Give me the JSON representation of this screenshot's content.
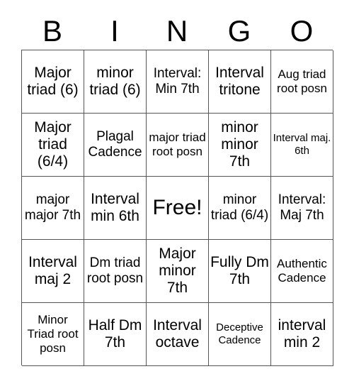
{
  "card": {
    "type": "bingo-card",
    "columns": 5,
    "rows": 5,
    "header_letters": [
      "B",
      "I",
      "N",
      "G",
      "O"
    ],
    "free_space": {
      "row": 3,
      "column": 3,
      "label": "Free!"
    },
    "colors": {
      "background": "#ffffff",
      "text": "#000000",
      "grid_line": "#555555"
    },
    "cells": [
      [
        {
          "text": "Major triad (6)",
          "size": "lg"
        },
        {
          "text": "minor triad (6)",
          "size": "lg"
        },
        {
          "text": "Interval: Min 7th",
          "size": "md"
        },
        {
          "text": "Interval tritone",
          "size": "lg"
        },
        {
          "text": "Aug triad root posn",
          "size": "sm"
        }
      ],
      [
        {
          "text": "Major triad (6/4)",
          "size": "lg"
        },
        {
          "text": "Plagal Cadence",
          "size": "md"
        },
        {
          "text": "major triad root posn",
          "size": "sm"
        },
        {
          "text": "minor minor 7th",
          "size": "lg"
        },
        {
          "text": "Interval maj. 6th",
          "size": "xs"
        }
      ],
      [
        {
          "text": "major major 7th",
          "size": "md"
        },
        {
          "text": "Interval min 6th",
          "size": "lg"
        },
        {
          "text": "Free!",
          "size": "xl"
        },
        {
          "text": "minor triad (6/4)",
          "size": "md"
        },
        {
          "text": "Interval: Maj 7th",
          "size": "md"
        }
      ],
      [
        {
          "text": "Interval maj 2",
          "size": "lg"
        },
        {
          "text": "Dm triad root posn",
          "size": "md"
        },
        {
          "text": "Major minor 7th",
          "size": "lg"
        },
        {
          "text": "Fully Dm 7th",
          "size": "lg"
        },
        {
          "text": "Authentic Cadence",
          "size": "sm"
        }
      ],
      [
        {
          "text": "Minor Triad root posn",
          "size": "sm"
        },
        {
          "text": "Half Dm 7th",
          "size": "lg"
        },
        {
          "text": "Interval octave",
          "size": "lg"
        },
        {
          "text": "Deceptive Cadence",
          "size": "xs"
        },
        {
          "text": "interval min 2",
          "size": "lg"
        }
      ]
    ]
  }
}
